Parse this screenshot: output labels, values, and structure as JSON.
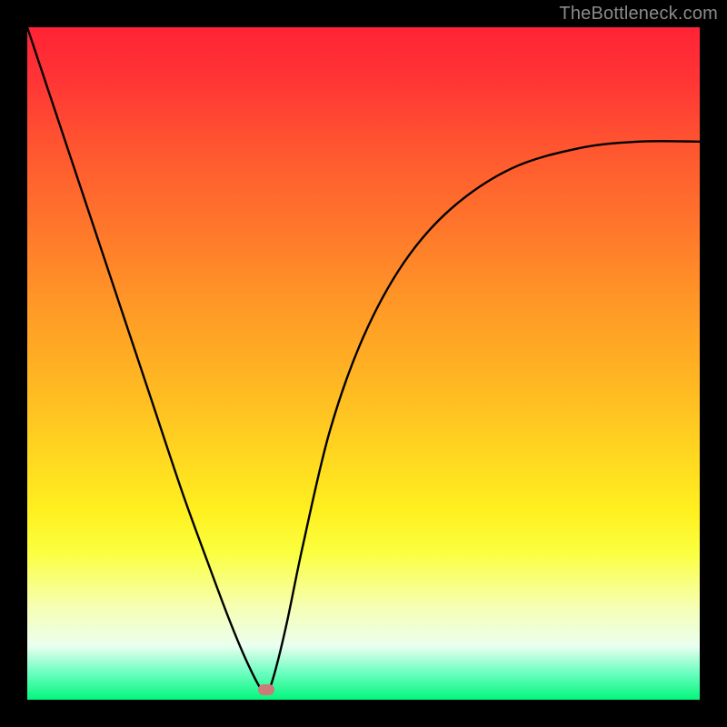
{
  "watermark": "TheBottleneck.com",
  "marker": {
    "x_frac": 0.355,
    "y_frac": 0.985
  },
  "chart_data": {
    "type": "line",
    "title": "",
    "xlabel": "",
    "ylabel": "",
    "xlim": [
      0,
      1
    ],
    "ylim": [
      0,
      1
    ],
    "background_gradient": {
      "top": "#ff2335",
      "bottom": "#02f57b",
      "stops": [
        "red",
        "orange",
        "yellow",
        "pale-yellow",
        "green"
      ]
    },
    "note": "Axis scales are not labeled in the image; x/y values are normalized fractions (0 = left/top edge of plot area, 1 = right/bottom edge). 'value' is interpreted as curve height from bottom (1 - y_frac).",
    "series": [
      {
        "name": "bottleneck-curve",
        "x": [
          0.0,
          0.06,
          0.12,
          0.18,
          0.23,
          0.27,
          0.3,
          0.325,
          0.345,
          0.355,
          0.365,
          0.385,
          0.41,
          0.45,
          0.5,
          0.56,
          0.63,
          0.72,
          0.82,
          0.91,
          1.0
        ],
        "value": [
          1.0,
          0.82,
          0.64,
          0.46,
          0.31,
          0.2,
          0.12,
          0.06,
          0.02,
          0.01,
          0.03,
          0.11,
          0.23,
          0.4,
          0.54,
          0.65,
          0.73,
          0.79,
          0.82,
          0.83,
          0.83
        ]
      }
    ],
    "marker_point": {
      "x": 0.355,
      "value": 0.015
    }
  }
}
